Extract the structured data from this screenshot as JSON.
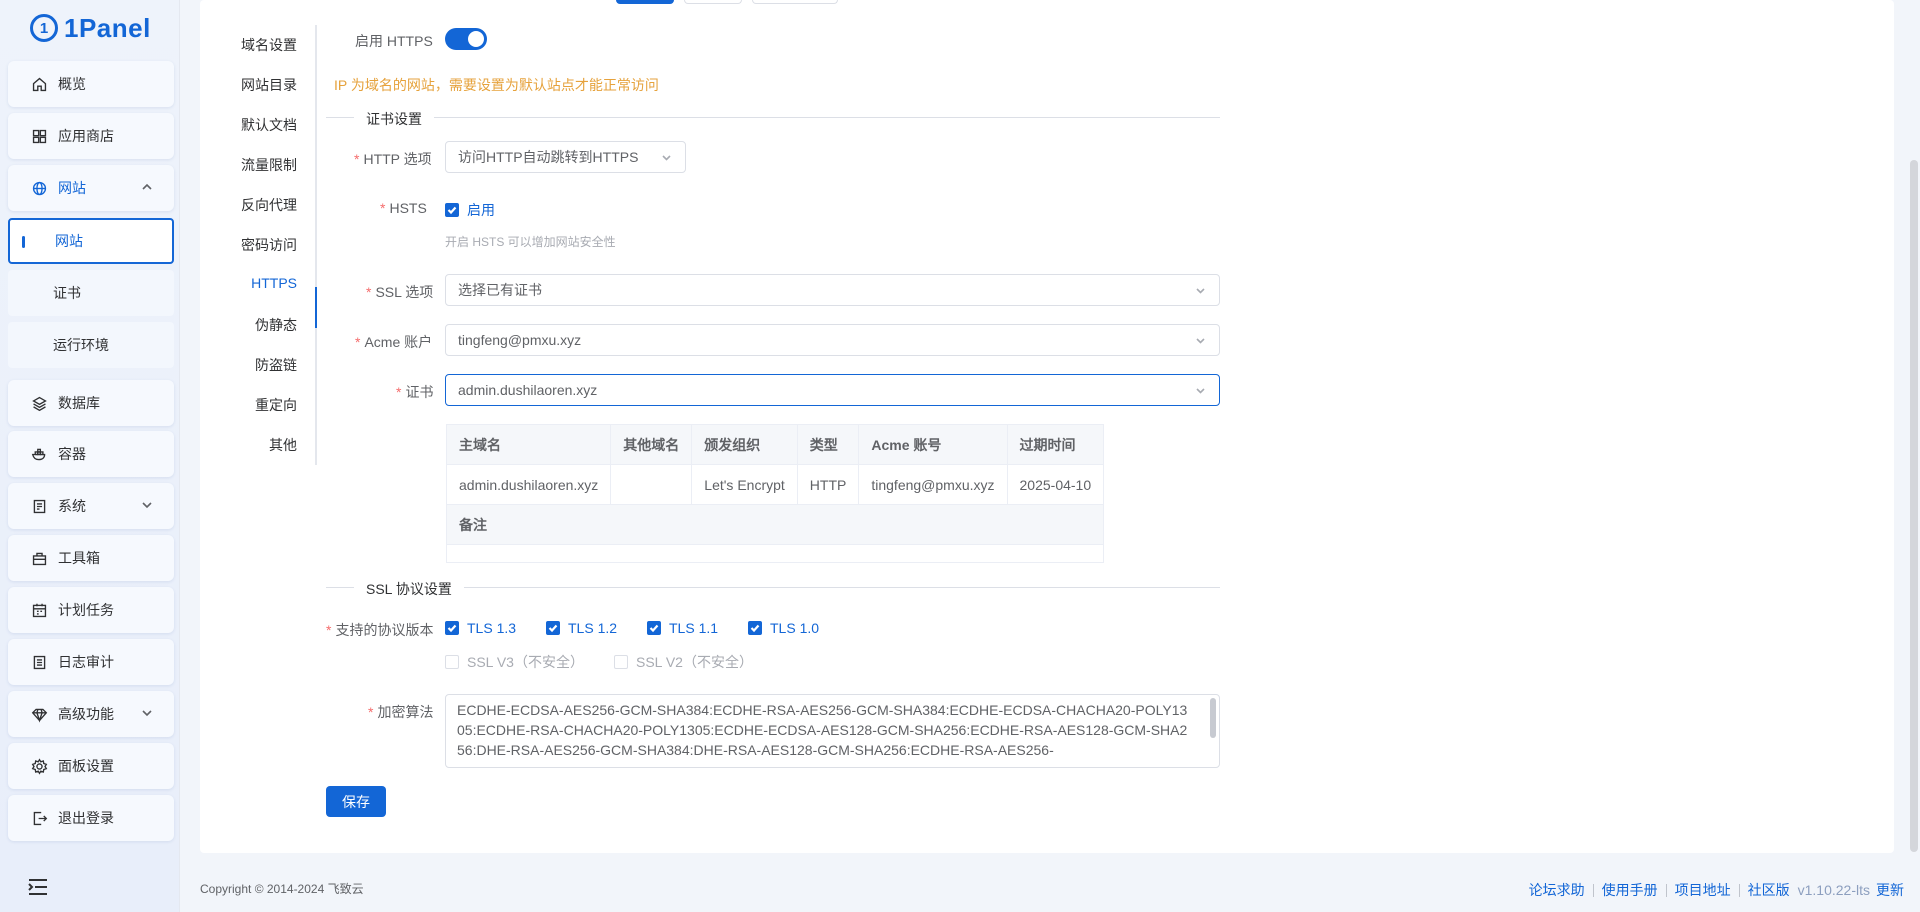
{
  "brand": {
    "name": "1Panel",
    "mark": "1"
  },
  "sidebar": {
    "items": [
      {
        "label": "概览",
        "icon": "home-icon"
      },
      {
        "label": "应用商店",
        "icon": "grid-icon"
      },
      {
        "label": "网站",
        "icon": "globe-icon",
        "expanded": true
      },
      {
        "label": "数据库",
        "icon": "layers-icon"
      },
      {
        "label": "容器",
        "icon": "docker-icon"
      },
      {
        "label": "系统",
        "icon": "server-icon"
      },
      {
        "label": "工具箱",
        "icon": "toolbox-icon"
      },
      {
        "label": "计划任务",
        "icon": "calendar-icon"
      },
      {
        "label": "日志审计",
        "icon": "log-icon"
      },
      {
        "label": "高级功能",
        "icon": "diamond-icon"
      },
      {
        "label": "面板设置",
        "icon": "gear-icon"
      },
      {
        "label": "退出登录",
        "icon": "logout-icon"
      }
    ],
    "sub_items": [
      "网站",
      "证书",
      "运行环境"
    ]
  },
  "tabs": [
    "域名设置",
    "网站目录",
    "默认文档",
    "流量限制",
    "反向代理",
    "密码访问",
    "HTTPS",
    "伪静态",
    "防盗链",
    "重定向",
    "其他"
  ],
  "active_tab": "HTTPS",
  "form": {
    "https_label": "启用 HTTPS",
    "https_enabled": true,
    "warning": "IP 为域名的网站，需要设置为默认站点才能正常访问",
    "cert_section": "证书设置",
    "http_option_label": "HTTP 选项",
    "http_option_value": "访问HTTP自动跳转到HTTPS",
    "hsts_label": "HSTS",
    "hsts_checkbox": "启用",
    "hsts_hint": "开启 HSTS 可以增加网站安全性",
    "ssl_option_label": "SSL 选项",
    "ssl_option_value": "选择已有证书",
    "acme_label": "Acme 账户",
    "acme_value": "tingfeng@pmxu.xyz",
    "cert_label": "证书",
    "cert_value": "admin.dushilaoren.xyz",
    "ssl_section": "SSL 协议设置",
    "protocol_label": "支持的协议版本",
    "protocols_on": [
      "TLS 1.3",
      "TLS 1.2",
      "TLS 1.1",
      "TLS 1.0"
    ],
    "protocols_off": [
      "SSL V3（不安全）",
      "SSL V2（不安全）"
    ],
    "cipher_label": "加密算法",
    "cipher_value": "ECDHE-ECDSA-AES256-GCM-SHA384:ECDHE-RSA-AES256-GCM-SHA384:ECDHE-ECDSA-CHACHA20-POLY1305:ECDHE-RSA-CHACHA20-POLY1305:ECDHE-ECDSA-AES128-GCM-SHA256:ECDHE-RSA-AES128-GCM-SHA256:DHE-RSA-AES256-GCM-SHA384:DHE-RSA-AES128-GCM-SHA256:ECDHE-RSA-AES256-",
    "save": "保存"
  },
  "cert_table": {
    "headers": [
      "主域名",
      "其他域名",
      "颁发组织",
      "类型",
      "Acme 账号",
      "过期时间"
    ],
    "row": [
      "admin.dushilaoren.xyz",
      "",
      "Let's Encrypt",
      "HTTP",
      "tingfeng@pmxu.xyz",
      "2025-04-10"
    ],
    "note_header": "备注",
    "note_value": ""
  },
  "footer": {
    "copyright": "Copyright © 2014-2024 飞致云",
    "links": [
      "论坛求助",
      "使用手册",
      "项目地址",
      "社区版"
    ],
    "version": "v1.10.22-lts",
    "update": "更新"
  },
  "colors": {
    "primary": "#1366d6",
    "warning": "#e6a23c",
    "required": "#f56c6c"
  }
}
